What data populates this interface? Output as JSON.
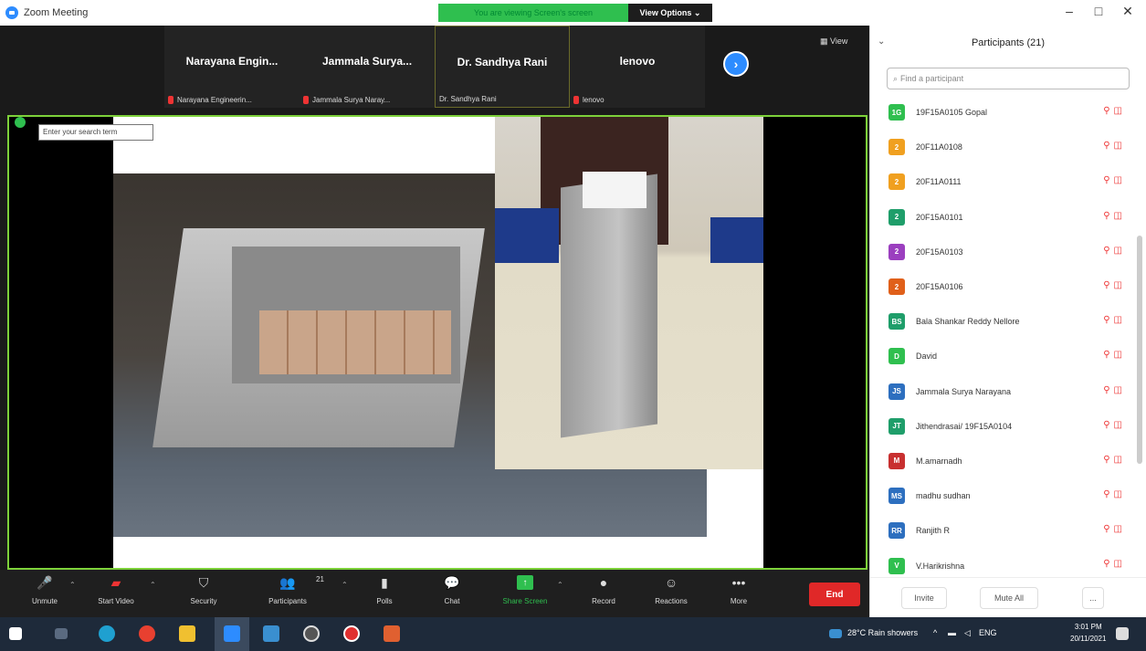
{
  "window": {
    "title": "Zoom Meeting",
    "share_banner": "You are viewing Screen's screen",
    "view_options": "View Options ⌄",
    "controls": [
      "–",
      "□",
      "✕"
    ]
  },
  "strip": {
    "tiles": [
      {
        "name": "Narayana  Engin...",
        "label": "Narayana Engineerin..."
      },
      {
        "name": "Jammala  Surya...",
        "label": "Jammala Surya Naray..."
      },
      {
        "name": "Dr. Sandhya Rani",
        "label": "Dr. Sandhya Rani"
      },
      {
        "name": "lenovo",
        "label": "lenovo"
      }
    ],
    "next_icon": "›",
    "view_label": "▦ View"
  },
  "share": {
    "search_hint": "Enter your search term"
  },
  "toolbar": {
    "items": [
      {
        "label": "Unmute",
        "icon": "🎤"
      },
      {
        "label": "Start Video",
        "icon": "▰"
      },
      {
        "label": "Security",
        "icon": "⛉"
      },
      {
        "label": "Participants",
        "icon": "👥"
      },
      {
        "label": "Polls",
        "icon": "▮"
      },
      {
        "label": "Chat",
        "icon": "💬"
      },
      {
        "label": "Share Screen",
        "icon": "↑"
      },
      {
        "label": "Record",
        "icon": "●"
      },
      {
        "label": "Reactions",
        "icon": "☺"
      },
      {
        "label": "More",
        "icon": "•••"
      }
    ],
    "participant_count": "21",
    "end_label": "End"
  },
  "panel": {
    "title": "Participants (21)",
    "collapse_icon": "⌄",
    "search_placeholder": "Find a participant",
    "participants": [
      {
        "initials": "1G",
        "name": "19F15A0105 Gopal",
        "color": "#2fbf4f"
      },
      {
        "initials": "2",
        "name": "20F11A0108",
        "color": "#f0a020"
      },
      {
        "initials": "2",
        "name": "20F11A0111",
        "color": "#f0a020"
      },
      {
        "initials": "2",
        "name": "20F15A0101",
        "color": "#1f9e6a"
      },
      {
        "initials": "2",
        "name": "20F15A0103",
        "color": "#9b3fbf"
      },
      {
        "initials": "2",
        "name": "20F15A0106",
        "color": "#e0601a"
      },
      {
        "initials": "BS",
        "name": "Bala Shankar Reddy Nellore",
        "color": "#1f9e6a"
      },
      {
        "initials": "D",
        "name": "David",
        "color": "#2fbf4f"
      },
      {
        "initials": "JS",
        "name": "Jammala Surya Narayana",
        "color": "#2d6fbf"
      },
      {
        "initials": "JT",
        "name": "Jithendrasai/ 19F15A0104",
        "color": "#1f9e6a"
      },
      {
        "initials": "M",
        "name": "M.amarnadh",
        "color": "#c83030"
      },
      {
        "initials": "MS",
        "name": "madhu sudhan",
        "color": "#2d6fbf"
      },
      {
        "initials": "RR",
        "name": "Ranjith R",
        "color": "#2d6fbf"
      },
      {
        "initials": "V",
        "name": "V.Harikrishna",
        "color": "#2fbf4f"
      }
    ],
    "invite": "Invite",
    "mute_all": "Mute All",
    "more": "..."
  },
  "taskbar": {
    "weather": "28°C  Rain showers",
    "lang": "ENG",
    "time": "3:01 PM",
    "date": "20/11/2021"
  }
}
